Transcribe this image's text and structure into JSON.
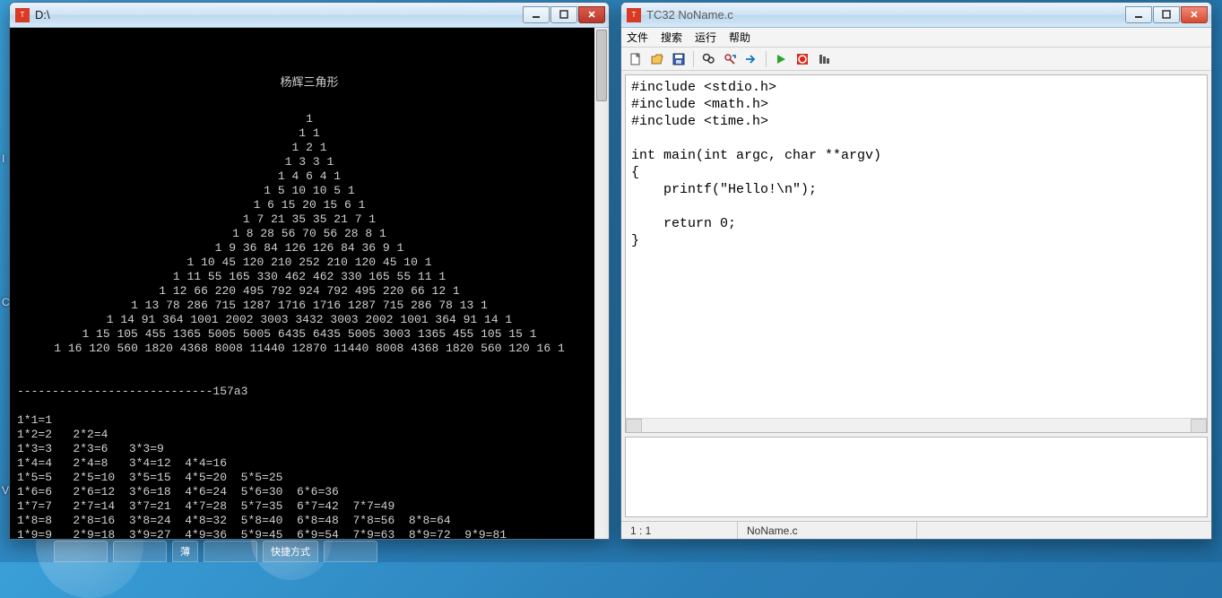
{
  "console": {
    "title": "D:\\",
    "heading": "杨辉三角形",
    "pascal_rows": [
      "1",
      "1 1",
      "1 2 1",
      "1 3 3 1",
      "1 4 6 4 1",
      "1 5 10 10 5 1",
      "1 6 15 20 15 6 1",
      "1 7 21 35 35 21 7 1",
      "1 8 28 56 70 56 28 8 1",
      "1 9 36 84 126 126 84 36 9 1",
      "1 10 45 120 210 252 210 120 45 10 1",
      "1 11 55 165 330 462 462 330 165 55 11 1",
      "1 12 66 220 495 792 924 792 495 220 66 12 1",
      "1 13 78 286 715 1287 1716 1716 1287 715 286 78 13 1",
      "1 14 91 364 1001 2002 3003 3432 3003 2002 1001 364 91 14 1",
      "1 15 105 455 1365 5005 5005 6435 6435 5005 3003 1365 455 105 15 1",
      "1 16 120 560 1820 4368 8008 11440 12870 11440 8008 4368 1820 560 120 16 1"
    ],
    "divider": "----------------------------157a3",
    "mult_table": [
      "1*1=1",
      "1*2=2   2*2=4",
      "1*3=3   2*3=6   3*3=9",
      "1*4=4   2*4=8   3*4=12  4*4=16",
      "1*5=5   2*5=10  3*5=15  4*5=20  5*5=25",
      "1*6=6   2*6=12  3*6=18  4*6=24  5*6=30  6*6=36",
      "1*7=7   2*7=14  3*7=21  4*7=28  5*7=35  6*7=42  7*7=49",
      "1*8=8   2*8=16  3*8=24  4*8=32  5*8=40  6*8=48  7*8=56  8*8=64",
      "1*9=9   2*9=18  3*9=27  4*9=36  5*9=45  6*9=54  7*9=63  8*9=72  9*9=81"
    ]
  },
  "editor": {
    "title": "TC32 NoName.c",
    "menus": [
      "文件",
      "搜索",
      "运行",
      "帮助"
    ],
    "toolbar_icons": [
      {
        "name": "new-file-icon",
        "kind": "newfile"
      },
      {
        "name": "open-file-icon",
        "kind": "openfile"
      },
      {
        "name": "save-icon",
        "kind": "save"
      },
      {
        "name": "_sep"
      },
      {
        "name": "find-icon",
        "kind": "find"
      },
      {
        "name": "find-next-icon",
        "kind": "findnext"
      },
      {
        "name": "goto-icon",
        "kind": "goto"
      },
      {
        "name": "_sep"
      },
      {
        "name": "run-icon",
        "kind": "run"
      },
      {
        "name": "stop-icon",
        "kind": "stop"
      },
      {
        "name": "step-icon",
        "kind": "step"
      }
    ],
    "code": "#include <stdio.h>\n#include <math.h>\n#include <time.h>\n\nint main(int argc, char **argv)\n{\n    printf(\"Hello!\\n\");\n\n    return 0;\n}\n",
    "status": {
      "pos": "1 : 1",
      "filename": "NoName.c"
    }
  },
  "taskbar": {
    "labels": [
      "薄",
      "快捷方式"
    ]
  }
}
